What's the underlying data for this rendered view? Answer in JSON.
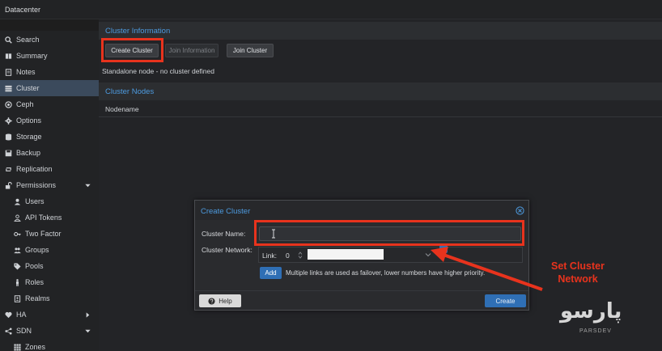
{
  "topbar": {
    "title": "Datacenter"
  },
  "sidebar": {
    "items": [
      {
        "label": "Search",
        "icon": "search-icon"
      },
      {
        "label": "Summary",
        "icon": "book-icon"
      },
      {
        "label": "Notes",
        "icon": "notes-icon"
      },
      {
        "label": "Cluster",
        "icon": "server-icon",
        "active": true
      },
      {
        "label": "Ceph",
        "icon": "ceph-icon"
      },
      {
        "label": "Options",
        "icon": "gear-icon"
      },
      {
        "label": "Storage",
        "icon": "database-icon"
      },
      {
        "label": "Backup",
        "icon": "floppy-icon"
      },
      {
        "label": "Replication",
        "icon": "retweet-icon"
      },
      {
        "label": "Permissions",
        "icon": "unlock-icon",
        "chevron": "down"
      },
      {
        "label": "Users",
        "icon": "user-icon"
      },
      {
        "label": "API Tokens",
        "icon": "user-outline-icon"
      },
      {
        "label": "Two Factor",
        "icon": "key-icon"
      },
      {
        "label": "Groups",
        "icon": "users-icon"
      },
      {
        "label": "Pools",
        "icon": "tags-icon"
      },
      {
        "label": "Roles",
        "icon": "male-icon"
      },
      {
        "label": "Realms",
        "icon": "address-book-icon"
      },
      {
        "label": "HA",
        "icon": "heartbeat-icon",
        "chevron": "right"
      },
      {
        "label": "SDN",
        "icon": "sdn-icon",
        "chevron": "down"
      },
      {
        "label": "Zones",
        "icon": "grid-icon"
      }
    ]
  },
  "main": {
    "cluster_info_header": "Cluster Information",
    "buttons": {
      "create_cluster": "Create Cluster",
      "join_information": "Join Information",
      "join_cluster": "Join Cluster"
    },
    "status_text": "Standalone node - no cluster defined",
    "cluster_nodes_header": "Cluster Nodes",
    "nodes_column": "Nodename"
  },
  "dialog": {
    "title": "Create Cluster",
    "cluster_name_label": "Cluster Name:",
    "cluster_name_value": "",
    "cluster_network_label": "Cluster Network:",
    "link_label": "Link:",
    "link_value": "0",
    "add_label": "Add",
    "info_text": "Multiple links are used as failover, lower numbers have higher priority.",
    "help_label": "Help",
    "create_label": "Create"
  },
  "annotation": {
    "text_line1": "Set Cluster",
    "text_line2": "Network",
    "color": "#e8331d"
  },
  "watermark": {
    "logo": "پارسو",
    "sub": "PARSDEV"
  },
  "colors": {
    "accent_blue": "#4d9be0",
    "button_blue": "#2f6fb5",
    "highlight_red": "#e8331d"
  }
}
